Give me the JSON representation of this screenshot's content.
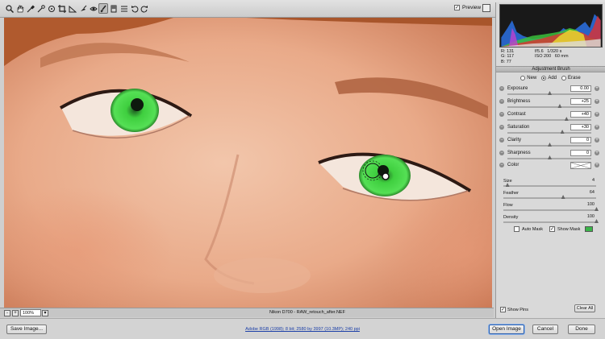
{
  "toolbar": {
    "tools": [
      "zoom-icon",
      "hand-icon",
      "white-balance-icon",
      "color-sampler-icon",
      "target-adjustment-icon",
      "crop-icon",
      "straighten-icon",
      "spot-removal-icon",
      "red-eye-icon",
      "adjustment-brush-icon",
      "graduated-filter-icon",
      "preferences-icon",
      "rotate-left-icon",
      "rotate-right-icon"
    ],
    "active_tool": "adjustment-brush-icon",
    "preview_label": "Preview",
    "preview_checked": true
  },
  "readout": {
    "r_label": "R:",
    "r_value": "131",
    "g_label": "G:",
    "g_value": "117",
    "b_label": "B:",
    "b_value": "77",
    "aperture": "f/5.6",
    "shutter": "1/320 s",
    "iso": "ISO 200",
    "focal": "60 mm"
  },
  "panel": {
    "title": "Adjustment Brush",
    "modes": [
      "New",
      "Add",
      "Erase"
    ],
    "selected_mode": "Add",
    "adjustments": [
      {
        "label": "Exposure",
        "value": "0.00",
        "level": 0.5
      },
      {
        "label": "Brightness",
        "value": "+25",
        "level": 0.62
      },
      {
        "label": "Contrast",
        "value": "+40",
        "level": 0.7
      },
      {
        "label": "Saturation",
        "value": "+30",
        "level": 0.65
      },
      {
        "label": "Clarity",
        "value": "0",
        "level": 0.5
      },
      {
        "label": "Sharpness",
        "value": "0",
        "level": 0.5
      }
    ],
    "color_label": "Color",
    "brush": [
      {
        "label": "Size",
        "value": "4",
        "level": 0.04
      },
      {
        "label": "Feather",
        "value": "64",
        "level": 0.64
      },
      {
        "label": "Flow",
        "value": "100",
        "level": 1.0
      },
      {
        "label": "Density",
        "value": "100",
        "level": 1.0
      }
    ],
    "auto_mask_label": "Auto Mask",
    "auto_mask_checked": false,
    "show_mask_label": "Show Mask",
    "show_mask_checked": true,
    "mask_color": "#3bb54a",
    "show_pins_label": "Show Pins",
    "show_pins_checked": true,
    "clear_all_label": "Clear All"
  },
  "status": {
    "zoom": "100%",
    "filename": "Nikon D700 - RAW_retouch_after.NEF"
  },
  "bottom": {
    "save_label": "Save Image...",
    "workflow": "Adobe RGB (1998); 8 bit; 2580 by 3997 (10.3MP); 240 ppi",
    "open_label": "Open Image",
    "cancel_label": "Cancel",
    "done_label": "Done"
  }
}
